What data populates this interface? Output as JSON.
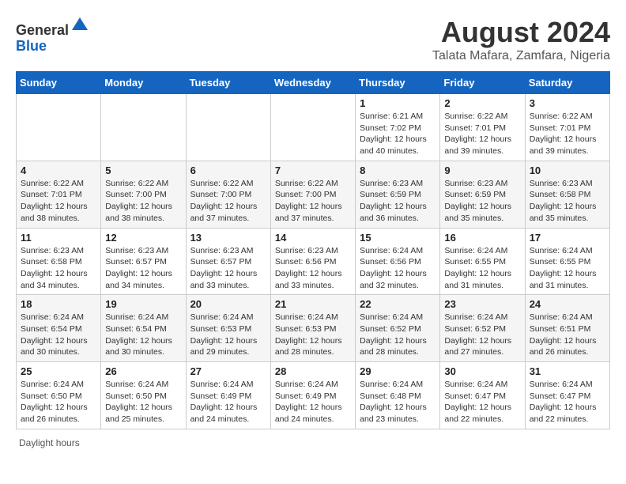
{
  "header": {
    "logo_general": "General",
    "logo_blue": "Blue",
    "month_title": "August 2024",
    "subtitle": "Talata Mafara, Zamfara, Nigeria"
  },
  "weekdays": [
    "Sunday",
    "Monday",
    "Tuesday",
    "Wednesday",
    "Thursday",
    "Friday",
    "Saturday"
  ],
  "weeks": [
    [
      {
        "day": "",
        "info": ""
      },
      {
        "day": "",
        "info": ""
      },
      {
        "day": "",
        "info": ""
      },
      {
        "day": "",
        "info": ""
      },
      {
        "day": "1",
        "info": "Sunrise: 6:21 AM\nSunset: 7:02 PM\nDaylight: 12 hours and 40 minutes."
      },
      {
        "day": "2",
        "info": "Sunrise: 6:22 AM\nSunset: 7:01 PM\nDaylight: 12 hours and 39 minutes."
      },
      {
        "day": "3",
        "info": "Sunrise: 6:22 AM\nSunset: 7:01 PM\nDaylight: 12 hours and 39 minutes."
      }
    ],
    [
      {
        "day": "4",
        "info": "Sunrise: 6:22 AM\nSunset: 7:01 PM\nDaylight: 12 hours and 38 minutes."
      },
      {
        "day": "5",
        "info": "Sunrise: 6:22 AM\nSunset: 7:00 PM\nDaylight: 12 hours and 38 minutes."
      },
      {
        "day": "6",
        "info": "Sunrise: 6:22 AM\nSunset: 7:00 PM\nDaylight: 12 hours and 37 minutes."
      },
      {
        "day": "7",
        "info": "Sunrise: 6:22 AM\nSunset: 7:00 PM\nDaylight: 12 hours and 37 minutes."
      },
      {
        "day": "8",
        "info": "Sunrise: 6:23 AM\nSunset: 6:59 PM\nDaylight: 12 hours and 36 minutes."
      },
      {
        "day": "9",
        "info": "Sunrise: 6:23 AM\nSunset: 6:59 PM\nDaylight: 12 hours and 35 minutes."
      },
      {
        "day": "10",
        "info": "Sunrise: 6:23 AM\nSunset: 6:58 PM\nDaylight: 12 hours and 35 minutes."
      }
    ],
    [
      {
        "day": "11",
        "info": "Sunrise: 6:23 AM\nSunset: 6:58 PM\nDaylight: 12 hours and 34 minutes."
      },
      {
        "day": "12",
        "info": "Sunrise: 6:23 AM\nSunset: 6:57 PM\nDaylight: 12 hours and 34 minutes."
      },
      {
        "day": "13",
        "info": "Sunrise: 6:23 AM\nSunset: 6:57 PM\nDaylight: 12 hours and 33 minutes."
      },
      {
        "day": "14",
        "info": "Sunrise: 6:23 AM\nSunset: 6:56 PM\nDaylight: 12 hours and 33 minutes."
      },
      {
        "day": "15",
        "info": "Sunrise: 6:24 AM\nSunset: 6:56 PM\nDaylight: 12 hours and 32 minutes."
      },
      {
        "day": "16",
        "info": "Sunrise: 6:24 AM\nSunset: 6:55 PM\nDaylight: 12 hours and 31 minutes."
      },
      {
        "day": "17",
        "info": "Sunrise: 6:24 AM\nSunset: 6:55 PM\nDaylight: 12 hours and 31 minutes."
      }
    ],
    [
      {
        "day": "18",
        "info": "Sunrise: 6:24 AM\nSunset: 6:54 PM\nDaylight: 12 hours and 30 minutes."
      },
      {
        "day": "19",
        "info": "Sunrise: 6:24 AM\nSunset: 6:54 PM\nDaylight: 12 hours and 30 minutes."
      },
      {
        "day": "20",
        "info": "Sunrise: 6:24 AM\nSunset: 6:53 PM\nDaylight: 12 hours and 29 minutes."
      },
      {
        "day": "21",
        "info": "Sunrise: 6:24 AM\nSunset: 6:53 PM\nDaylight: 12 hours and 28 minutes."
      },
      {
        "day": "22",
        "info": "Sunrise: 6:24 AM\nSunset: 6:52 PM\nDaylight: 12 hours and 28 minutes."
      },
      {
        "day": "23",
        "info": "Sunrise: 6:24 AM\nSunset: 6:52 PM\nDaylight: 12 hours and 27 minutes."
      },
      {
        "day": "24",
        "info": "Sunrise: 6:24 AM\nSunset: 6:51 PM\nDaylight: 12 hours and 26 minutes."
      }
    ],
    [
      {
        "day": "25",
        "info": "Sunrise: 6:24 AM\nSunset: 6:50 PM\nDaylight: 12 hours and 26 minutes."
      },
      {
        "day": "26",
        "info": "Sunrise: 6:24 AM\nSunset: 6:50 PM\nDaylight: 12 hours and 25 minutes."
      },
      {
        "day": "27",
        "info": "Sunrise: 6:24 AM\nSunset: 6:49 PM\nDaylight: 12 hours and 24 minutes."
      },
      {
        "day": "28",
        "info": "Sunrise: 6:24 AM\nSunset: 6:49 PM\nDaylight: 12 hours and 24 minutes."
      },
      {
        "day": "29",
        "info": "Sunrise: 6:24 AM\nSunset: 6:48 PM\nDaylight: 12 hours and 23 minutes."
      },
      {
        "day": "30",
        "info": "Sunrise: 6:24 AM\nSunset: 6:47 PM\nDaylight: 12 hours and 22 minutes."
      },
      {
        "day": "31",
        "info": "Sunrise: 6:24 AM\nSunset: 6:47 PM\nDaylight: 12 hours and 22 minutes."
      }
    ]
  ],
  "footer": {
    "daylight_label": "Daylight hours"
  }
}
